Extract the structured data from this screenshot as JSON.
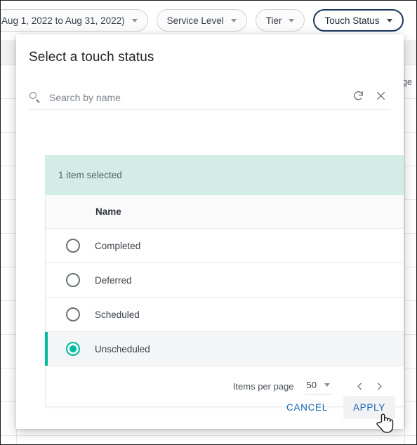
{
  "filter_bar": {
    "chips": [
      {
        "label": "Aug 1, 2022 to Aug 31, 2022)",
        "active": false
      },
      {
        "label": "Service Level",
        "active": false
      },
      {
        "label": "Tier",
        "active": false
      },
      {
        "label": "Touch Status",
        "active": true
      }
    ]
  },
  "background": {
    "visible_cell_text": "ge"
  },
  "dialog": {
    "title": "Select a touch status",
    "search": {
      "placeholder": "Search by name",
      "value": "",
      "search_icon": "search-icon",
      "refresh_icon": "refresh-icon",
      "clear_icon": "close-icon"
    },
    "selection_banner": "1 item selected",
    "table": {
      "columns": [
        "Name"
      ],
      "rows": [
        {
          "name": "Completed",
          "selected": false
        },
        {
          "name": "Deferred",
          "selected": false
        },
        {
          "name": "Scheduled",
          "selected": false
        },
        {
          "name": "Unscheduled",
          "selected": true
        }
      ]
    },
    "paginator": {
      "items_per_page_label": "Items per page",
      "items_per_page_value": "50",
      "prev_icon": "chevron-left-icon",
      "next_icon": "chevron-right-icon"
    },
    "actions": {
      "cancel_label": "CANCEL",
      "apply_label": "APPLY"
    }
  },
  "colors": {
    "accent_teal": "#00bb9e",
    "banner_bg": "#d3ece6",
    "link_blue": "#1767b3",
    "active_chip_border": "#17375e"
  }
}
